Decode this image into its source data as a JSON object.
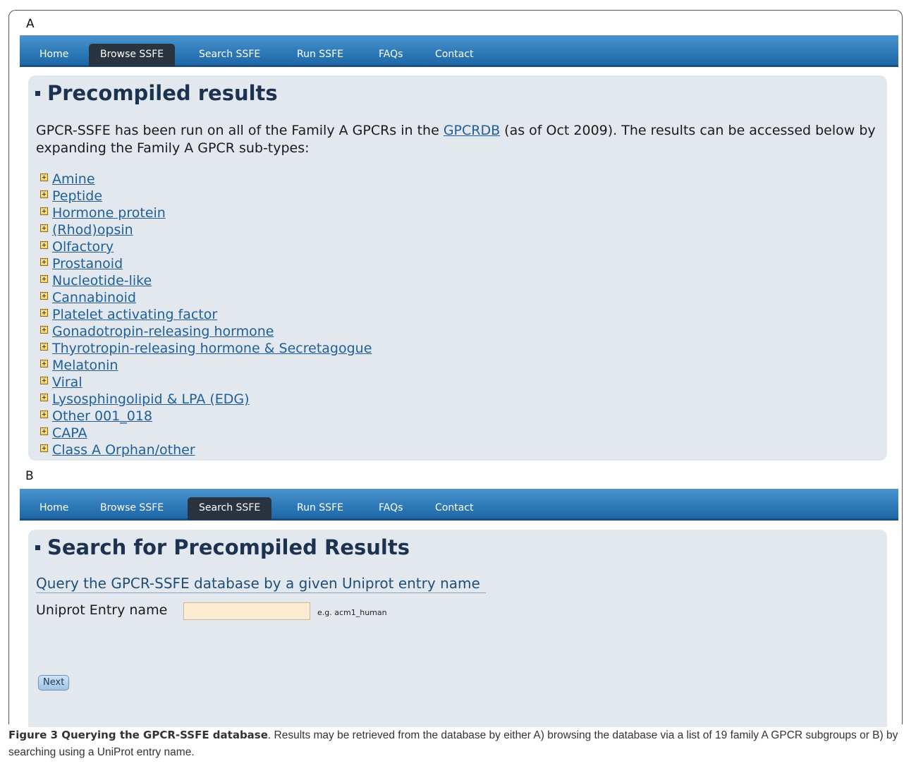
{
  "panel_a": {
    "letter": "A",
    "nav": [
      "Home",
      "Browse SSFE",
      "Search SSFE",
      "Run SSFE",
      "FAQs",
      "Contact"
    ],
    "active_tab": "Browse SSFE",
    "title": "Precompiled results",
    "intro_before": "GPCR-SSFE has been run on all of the Family A GPCRs in the ",
    "intro_link": "GPCRDB",
    "intro_after": " (as of Oct 2009). The results can be accessed below by expanding the Family A GPCR sub-types:",
    "subtypes": [
      "Amine",
      "Peptide",
      "Hormone protein",
      "(Rhod)opsin",
      "Olfactory",
      "Prostanoid",
      "Nucleotide-like",
      "Cannabinoid",
      "Platelet activating factor",
      "Gonadotropin-releasing hormone",
      "Thyrotropin-releasing hormone & Secretagogue",
      "Melatonin",
      "Viral",
      "Lysosphingolipid & LPA (EDG)",
      "Other 001_018",
      "CAPA",
      "Class A Orphan/other"
    ]
  },
  "panel_b": {
    "letter": "B",
    "nav": [
      "Home",
      "Browse SSFE",
      "Search SSFE",
      "Run SSFE",
      "FAQs",
      "Contact"
    ],
    "active_tab": "Search SSFE",
    "title": "Search for Precompiled Results",
    "query_heading": "Query the GPCR-SSFE database by a given Uniprot entry name",
    "field_label": "Uniprot Entry name",
    "field_value": "",
    "example": "e.g. acm1_human",
    "next_label": "Next"
  },
  "caption": {
    "title": "Figure 3 Querying the GPCR-SSFE database",
    "text": ". Results may be retrieved from the database by either A) browsing the database via a list of 19 family A GPCR subgroups or B) by searching using a UniProt entry name."
  },
  "colors": {
    "nav_blue": "#2f7bba",
    "nav_active": "#2a3340",
    "content_bg": "#e3e8ee",
    "title_color": "#1b3350",
    "link_color": "#1f5f99",
    "input_bg": "#fdebd2"
  }
}
